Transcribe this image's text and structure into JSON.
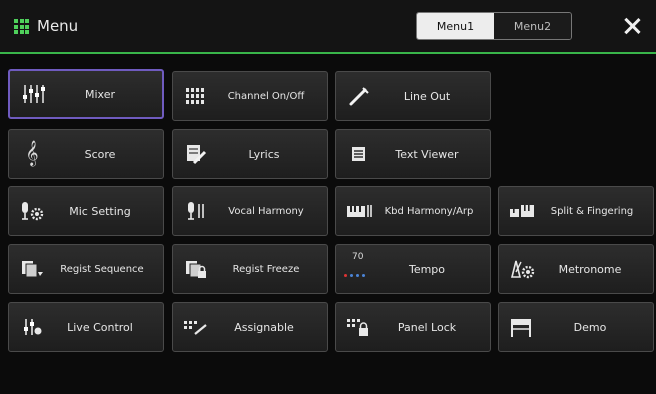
{
  "header": {
    "title": "Menu",
    "tabs": [
      {
        "label": "Menu1",
        "active": true
      },
      {
        "label": "Menu2",
        "active": false
      }
    ],
    "close_icon": "close-icon",
    "accent_color": "#39b54a"
  },
  "buttons": [
    {
      "label": "Mixer",
      "icon": "mixer-faders-icon",
      "selected": true
    },
    {
      "label": "Channel On/Off",
      "icon": "channel-grid-icon",
      "selected": false
    },
    {
      "label": "Line Out",
      "icon": "line-out-cable-icon",
      "selected": false
    },
    {
      "label": "Score",
      "icon": "treble-clef-icon",
      "selected": false
    },
    {
      "label": "Lyrics",
      "icon": "lyrics-pen-icon",
      "selected": false
    },
    {
      "label": "Text Viewer",
      "icon": "text-document-icon",
      "selected": false
    },
    {
      "label": "Mic Setting",
      "icon": "mic-gear-icon",
      "selected": false
    },
    {
      "label": "Vocal Harmony",
      "icon": "mic-harmony-icon",
      "selected": false
    },
    {
      "label": "Kbd Harmony/Arp",
      "icon": "keyboard-harmony-icon",
      "selected": false
    },
    {
      "label": "Split & Fingering",
      "icon": "split-keyboard-icon",
      "selected": false
    },
    {
      "label": "Regist Sequence",
      "icon": "regist-sequence-icon",
      "selected": false
    },
    {
      "label": "Regist Freeze",
      "icon": "regist-freeze-lock-icon",
      "selected": false
    },
    {
      "label": "Tempo",
      "icon": "tempo-dots-icon",
      "selected": false,
      "value": "70"
    },
    {
      "label": "Metronome",
      "icon": "metronome-gear-icon",
      "selected": false
    },
    {
      "label": "Live Control",
      "icon": "live-control-knobs-icon",
      "selected": false
    },
    {
      "label": "Assignable",
      "icon": "assignable-icon",
      "selected": false
    },
    {
      "label": "Panel Lock",
      "icon": "panel-lock-icon",
      "selected": false
    },
    {
      "label": "Demo",
      "icon": "demo-piano-icon",
      "selected": false
    }
  ],
  "selection_color": "#6f5bbf"
}
